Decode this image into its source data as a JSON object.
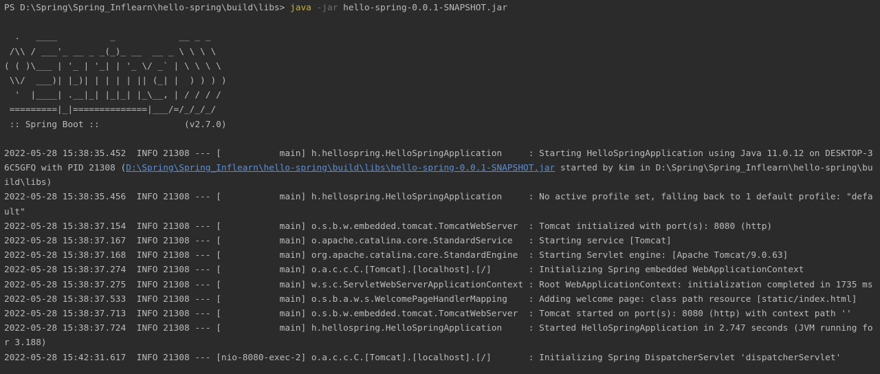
{
  "colors": {
    "background": "#2b2b2b",
    "text": "#bbbbbb",
    "java_keyword": "#c7b22f",
    "flag": "#6f6f6f",
    "link": "#5b8fd6"
  },
  "command": {
    "prompt": "PS D:\\Spring\\Spring_Inflearn\\hello-spring\\build\\libs> ",
    "java": "java",
    "flag": " -jar",
    "args": " hello-spring-0.0.1-SNAPSHOT.jar"
  },
  "banner": [
    "  .   ____          _            __ _ _",
    " /\\\\ / ___'_ __ _ _(_)_ __  __ _ \\ \\ \\ \\",
    "( ( )\\___ | '_ | '_| | '_ \\/ _` | \\ \\ \\ \\",
    " \\\\/  ___)| |_)| | | | | || (_| |  ) ) ) )",
    "  '  |____| .__|_| |_|_| |_\\__, | / / / /",
    " =========|_|==============|___/=/_/_/_/",
    " :: Spring Boot ::                (v2.7.0)"
  ],
  "log": {
    "line1a": "2022-05-28 15:38:35.452  INFO 21308 --- [           main] h.hellospring.HelloSpringApplication     : Starting HelloSpringApplication using Java 11.0.12 on DESKTOP-3",
    "line1b_prefix": "6C5GFQ with PID 21308 (",
    "line1b_link": "D:\\Spring\\Spring_Inflearn\\hello-spring\\build\\libs\\hello-spring-0.0.1-SNAPSHOT.jar",
    "line1b_suffix": " started by kim in D:\\Spring\\Spring_Inflearn\\hello-spring\\bu",
    "line1c": "ild\\libs)",
    "line2a": "2022-05-28 15:38:35.456  INFO 21308 --- [           main] h.hellospring.HelloSpringApplication     : No active profile set, falling back to 1 default profile: \"defa",
    "line2b": "ult\"",
    "line3": "2022-05-28 15:38:37.154  INFO 21308 --- [           main] o.s.b.w.embedded.tomcat.TomcatWebServer  : Tomcat initialized with port(s): 8080 (http)",
    "line4": "2022-05-28 15:38:37.167  INFO 21308 --- [           main] o.apache.catalina.core.StandardService   : Starting service [Tomcat]",
    "line5": "2022-05-28 15:38:37.168  INFO 21308 --- [           main] org.apache.catalina.core.StandardEngine  : Starting Servlet engine: [Apache Tomcat/9.0.63]",
    "line6": "2022-05-28 15:38:37.274  INFO 21308 --- [           main] o.a.c.c.C.[Tomcat].[localhost].[/]       : Initializing Spring embedded WebApplicationContext",
    "line7": "2022-05-28 15:38:37.275  INFO 21308 --- [           main] w.s.c.ServletWebServerApplicationContext : Root WebApplicationContext: initialization completed in 1735 ms",
    "line8": "2022-05-28 15:38:37.533  INFO 21308 --- [           main] o.s.b.a.w.s.WelcomePageHandlerMapping    : Adding welcome page: class path resource [static/index.html]",
    "line9": "2022-05-28 15:38:37.713  INFO 21308 --- [           main] o.s.b.w.embedded.tomcat.TomcatWebServer  : Tomcat started on port(s): 8080 (http) with context path ''",
    "line10a": "2022-05-28 15:38:37.724  INFO 21308 --- [           main] h.hellospring.HelloSpringApplication     : Started HelloSpringApplication in 2.747 seconds (JVM running fo",
    "line10b": "r 3.188)",
    "line11": "2022-05-28 15:42:31.617  INFO 21308 --- [nio-8080-exec-2] o.a.c.c.C.[Tomcat].[localhost].[/]       : Initializing Spring DispatcherServlet 'dispatcherServlet'"
  }
}
